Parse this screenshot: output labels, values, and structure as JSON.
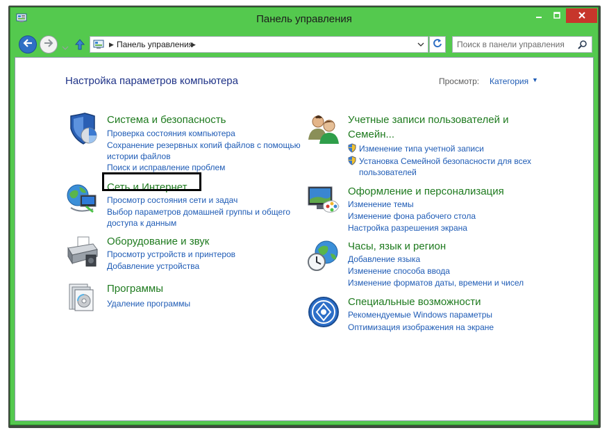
{
  "window": {
    "title": "Панель управления"
  },
  "navigation": {
    "breadcrumb": "Панель управления",
    "search_placeholder": "Поиск в панели управления"
  },
  "header": {
    "page_title": "Настройка параметров компьютера",
    "view_label": "Просмотр:",
    "view_value": "Категория"
  },
  "categories": {
    "system": {
      "icon": "shield-icon",
      "title": "Система и безопасность",
      "links": [
        "Проверка состояния компьютера",
        "Сохранение резервных копий файлов с помощью",
        "истории файлов",
        "Поиск и исправление проблем"
      ]
    },
    "network": {
      "icon": "globe-network-icon",
      "title": "Сеть и Интернет",
      "links": [
        "Просмотр состояния сети и задач",
        "Выбор параметров домашней группы и общего",
        "доступа к данным"
      ]
    },
    "hardware": {
      "icon": "printer-icon",
      "title": "Оборудование и звук",
      "links": [
        "Просмотр устройств и принтеров",
        "Добавление устройства"
      ]
    },
    "programs": {
      "icon": "programs-icon",
      "title": "Программы",
      "links": [
        "Удаление программы"
      ]
    },
    "accounts": {
      "icon": "users-icon",
      "title_line1": "Учетные записи пользователей и",
      "title_line2": "Семейн...",
      "links": [
        "Изменение типа учетной записи",
        "Установка Семейной безопасности для всех",
        "пользователей"
      ]
    },
    "appearance": {
      "icon": "monitor-palette-icon",
      "title": "Оформление и персонализация",
      "links": [
        "Изменение темы",
        "Изменение фона рабочего стола",
        "Настройка разрешения экрана"
      ]
    },
    "clock": {
      "icon": "clock-globe-icon",
      "title": "Часы, язык и регион",
      "links": [
        "Добавление языка",
        "Изменение способа ввода",
        "Изменение форматов даты, времени и чисел"
      ]
    },
    "access": {
      "icon": "accessibility-icon",
      "title": "Специальные возможности",
      "links": [
        "Рекомендуемые Windows параметры",
        "Оптимизация изображения на экране"
      ]
    }
  },
  "colors": {
    "window_frame": "#54c94e",
    "close_button": "#c7362b",
    "category_title": "#1e7a1e",
    "link": "#1e5bb5",
    "page_title": "#1e3287"
  }
}
